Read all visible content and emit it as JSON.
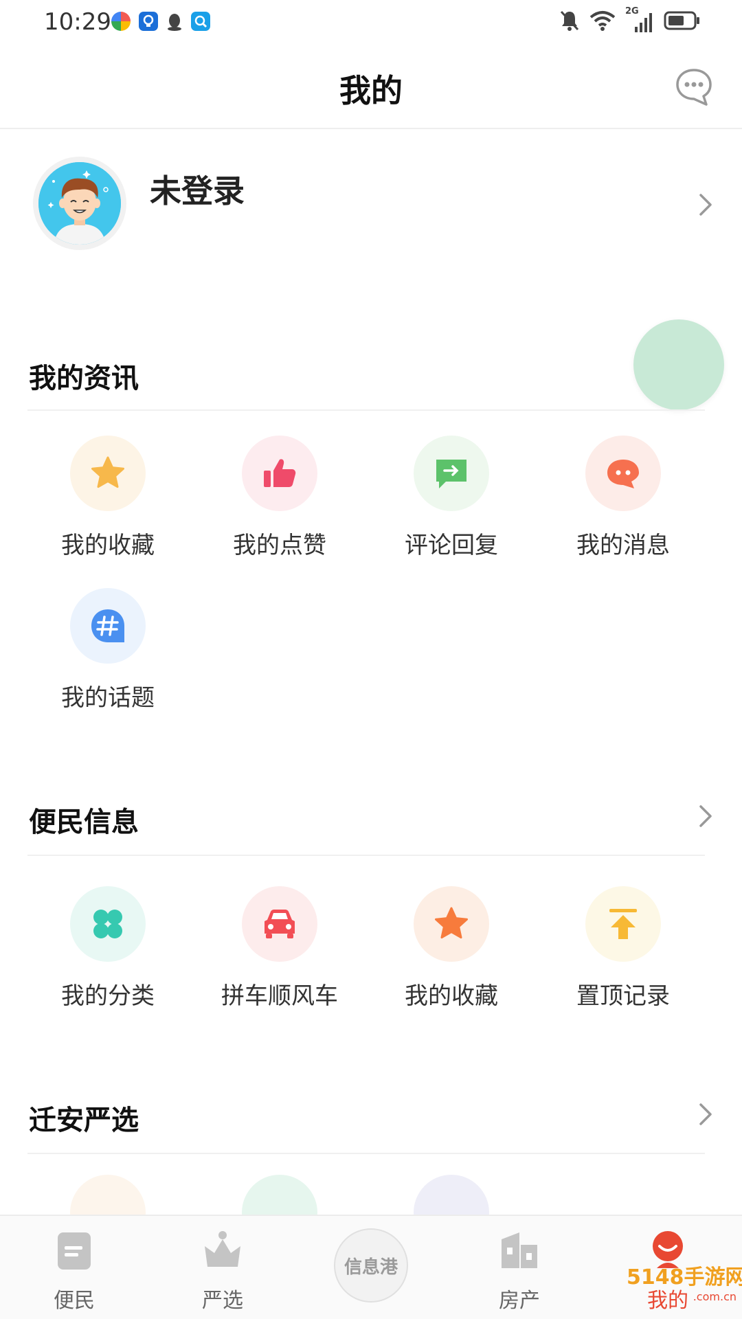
{
  "status_bar": {
    "time": "10:29",
    "network_label": "2G",
    "icons": [
      "swirl-app-icon",
      "bulb-app-icon",
      "penguin-app-icon",
      "search-app-icon",
      "bell-muted-icon",
      "wifi-icon",
      "signal-icon",
      "battery-icon"
    ]
  },
  "header": {
    "title": "我的",
    "chat_icon": "chat-bubble-icon"
  },
  "profile": {
    "login_status": "未登录",
    "avatar_icon": "cartoon-avatar-icon"
  },
  "sections": {
    "news": {
      "title": "我的资讯",
      "items": [
        {
          "label": "我的收藏",
          "icon": "star-icon",
          "color": "#f7b84b",
          "bg": "#fdf4e6"
        },
        {
          "label": "我的点赞",
          "icon": "thumbs-up-icon",
          "color": "#ef4b6a",
          "bg": "#fdecef"
        },
        {
          "label": "评论回复",
          "icon": "comment-reply-icon",
          "color": "#5cc26a",
          "bg": "#eef8ee"
        },
        {
          "label": "我的消息",
          "icon": "message-icon",
          "color": "#f6704f",
          "bg": "#fdece8"
        },
        {
          "label": "我的话题",
          "icon": "hashtag-icon",
          "color": "#4a90f0",
          "bg": "#ebf3fd"
        }
      ]
    },
    "services": {
      "title": "便民信息",
      "items": [
        {
          "label": "我的分类",
          "icon": "clover-icon",
          "color": "#36c9b0",
          "bg": "#e8f8f4"
        },
        {
          "label": "拼车顺风车",
          "icon": "car-icon",
          "color": "#f24e55",
          "bg": "#fdecec"
        },
        {
          "label": "我的收藏",
          "icon": "star-icon",
          "color": "#f77b3c",
          "bg": "#fdeee4"
        },
        {
          "label": "置顶记录",
          "icon": "pin-top-icon",
          "color": "#f7b935",
          "bg": "#fdf8e6"
        }
      ]
    },
    "shop": {
      "title": "迁安严选"
    }
  },
  "bottom_nav": {
    "items": [
      {
        "label": "便民",
        "icon": "document-icon"
      },
      {
        "label": "严选",
        "icon": "crown-icon"
      },
      {
        "label": "信息港",
        "icon": "center-logo"
      },
      {
        "label": "房产",
        "icon": "building-icon"
      },
      {
        "label": "我的",
        "icon": "smile-user-icon",
        "active": true
      }
    ]
  },
  "watermark": {
    "text": "5148手游网",
    "domain": ".com.cn"
  }
}
